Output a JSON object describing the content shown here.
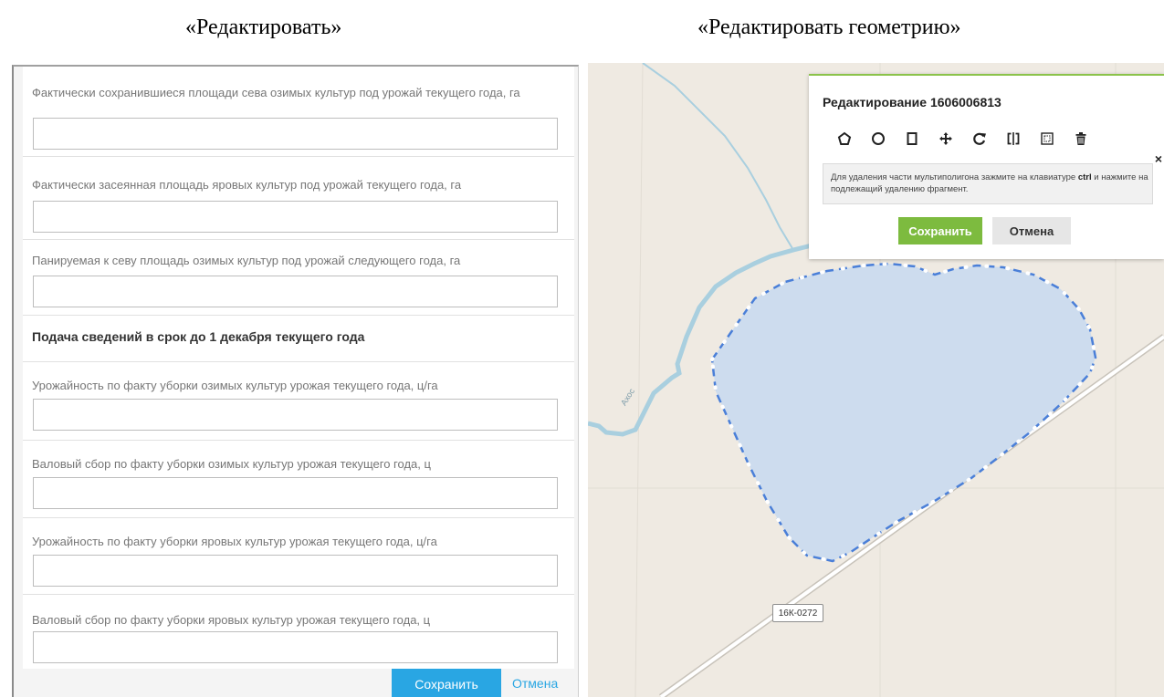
{
  "captions": {
    "left": "«Редактировать»",
    "right": "«Редактировать геометрию»"
  },
  "form": {
    "fields": [
      {
        "label": "Фактически сохранившиеся площади сева озимых культур под урожай текущего года, га",
        "value": ""
      },
      {
        "label": "Фактически засеянная площадь яровых культур под урожай текущего года, га",
        "value": ""
      },
      {
        "label": "Панируемая к севу площадь озимых культур под урожай следующего года, га",
        "value": ""
      }
    ],
    "section_title": "Подача сведений в срок до 1 декабря текущего года",
    "fields2": [
      {
        "label": "Урожайность по факту уборки озимых культур урожая текущего года, ц/га",
        "value": ""
      },
      {
        "label": "Валовый сбор по факту уборки озимых культур урожая текущего года, ц",
        "value": ""
      },
      {
        "label": "Урожайность по факту уборки яровых культур урожая текущего года, ц/га",
        "value": ""
      },
      {
        "label": "Валовый сбор по факту уборки яровых культур урожая текущего года, ц",
        "value": ""
      }
    ],
    "save_label": "Сохранить",
    "cancel_label": "Отмена",
    "accent_color": "#29a6e3"
  },
  "map": {
    "road_label": "16К-0272",
    "river_label": "Ахос",
    "popup": {
      "title": "Редактирование 1606006813",
      "tools": [
        "polygon-icon",
        "circle-icon",
        "rectangle-icon",
        "move-icon",
        "rotate-icon",
        "split-icon",
        "select-area-icon",
        "delete-icon"
      ],
      "close": "×",
      "hint_part1": "Для удаления части мультиполигона зажмите на клавиатуре ",
      "hint_key": "ctrl",
      "hint_part2": " и нажмите на подлежащий удалению фрагмент.",
      "save_label": "Сохранить",
      "cancel_label": "Отмена",
      "save_color": "#7dbb3f"
    }
  }
}
